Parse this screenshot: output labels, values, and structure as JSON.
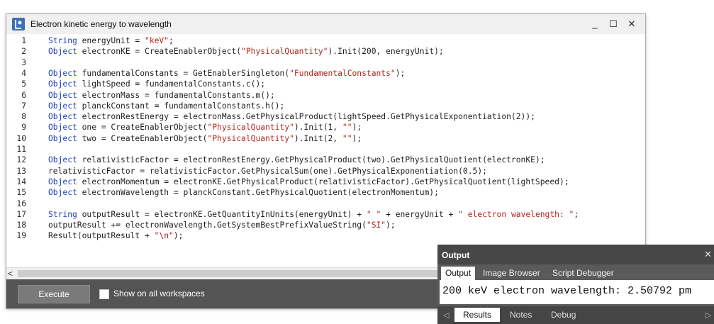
{
  "window": {
    "title": "Electron kinetic energy to wavelength",
    "minimize_label": "_",
    "maximize_label": "☐",
    "close_label": "✕"
  },
  "editor": {
    "lines": [
      {
        "num": "1",
        "tokens": [
          {
            "t": "String",
            "c": "kw"
          },
          {
            "t": " energyUnit = "
          },
          {
            "t": "\"keV\"",
            "c": "str"
          },
          {
            "t": ";"
          }
        ]
      },
      {
        "num": "2",
        "tokens": [
          {
            "t": "Object",
            "c": "kw"
          },
          {
            "t": " electronKE = CreateEnablerObject("
          },
          {
            "t": "\"PhysicalQuantity\"",
            "c": "str"
          },
          {
            "t": ").Init(200, energyUnit);"
          }
        ]
      },
      {
        "num": "3",
        "tokens": []
      },
      {
        "num": "4",
        "tokens": [
          {
            "t": "Object",
            "c": "kw"
          },
          {
            "t": " fundamentalConstants = GetEnablerSingleton("
          },
          {
            "t": "\"FundamentalConstants\"",
            "c": "str"
          },
          {
            "t": ");"
          }
        ]
      },
      {
        "num": "5",
        "tokens": [
          {
            "t": "Object",
            "c": "kw"
          },
          {
            "t": " lightSpeed = fundamentalConstants.c();"
          }
        ]
      },
      {
        "num": "6",
        "tokens": [
          {
            "t": "Object",
            "c": "kw"
          },
          {
            "t": " electronMass = fundamentalConstants.m();"
          }
        ]
      },
      {
        "num": "7",
        "tokens": [
          {
            "t": "Object",
            "c": "kw"
          },
          {
            "t": " planckConstant = fundamentalConstants.h();"
          }
        ]
      },
      {
        "num": "8",
        "tokens": [
          {
            "t": "Object",
            "c": "kw"
          },
          {
            "t": " electronRestEnergy = electronMass.GetPhysicalProduct(lightSpeed.GetPhysicalExponentiation(2));"
          }
        ]
      },
      {
        "num": "9",
        "tokens": [
          {
            "t": "Object",
            "c": "kw"
          },
          {
            "t": " one = CreateEnablerObject("
          },
          {
            "t": "\"PhysicalQuantity\"",
            "c": "str"
          },
          {
            "t": ").Init(1, "
          },
          {
            "t": "\"\"",
            "c": "str"
          },
          {
            "t": ");"
          }
        ]
      },
      {
        "num": "10",
        "tokens": [
          {
            "t": "Object",
            "c": "kw"
          },
          {
            "t": " two = CreateEnablerObject("
          },
          {
            "t": "\"PhysicalQuantity\"",
            "c": "str"
          },
          {
            "t": ").Init(2, "
          },
          {
            "t": "\"\"",
            "c": "str"
          },
          {
            "t": ");"
          }
        ]
      },
      {
        "num": "11",
        "tokens": []
      },
      {
        "num": "12",
        "tokens": [
          {
            "t": "Object",
            "c": "kw"
          },
          {
            "t": " relativisticFactor = electronRestEnergy.GetPhysicalProduct(two).GetPhysicalQuotient(electronKE);"
          }
        ]
      },
      {
        "num": "13",
        "tokens": [
          {
            "t": "relativisticFactor = relativisticFactor.GetPhysicalSum(one).GetPhysicalExponentiation(0.5);"
          }
        ]
      },
      {
        "num": "14",
        "tokens": [
          {
            "t": "Object",
            "c": "kw"
          },
          {
            "t": " electronMomentum = electronKE.GetPhysicalProduct(relativisticFactor).GetPhysicalQuotient(lightSpeed);"
          }
        ]
      },
      {
        "num": "15",
        "tokens": [
          {
            "t": "Object",
            "c": "kw"
          },
          {
            "t": " electronWavelength = planckConstant.GetPhysicalQuotient(electronMomentum);"
          }
        ]
      },
      {
        "num": "16",
        "tokens": []
      },
      {
        "num": "17",
        "tokens": [
          {
            "t": "String",
            "c": "kw"
          },
          {
            "t": " outputResult = electronKE.GetQuantityInUnits(energyUnit) + "
          },
          {
            "t": "\" \"",
            "c": "str"
          },
          {
            "t": " + energyUnit + "
          },
          {
            "t": "\" electron wavelength: \"",
            "c": "str"
          },
          {
            "t": ";"
          }
        ]
      },
      {
        "num": "18",
        "tokens": [
          {
            "t": "outputResult += electronWavelength.GetSystemBestPrefixValueString("
          },
          {
            "t": "\"SI\"",
            "c": "str"
          },
          {
            "t": ");"
          }
        ]
      },
      {
        "num": "19",
        "tokens": [
          {
            "t": "Result(outputResult + "
          },
          {
            "t": "\"\\n\"",
            "c": "str"
          },
          {
            "t": ");"
          }
        ]
      }
    ]
  },
  "scroll": {
    "left_arrow": "<"
  },
  "bottom_bar": {
    "execute_label": "Execute",
    "show_all_label": "Show on all workspaces"
  },
  "output": {
    "title": "Output",
    "close_label": "✕",
    "tabs": [
      "Output",
      "Image Browser",
      "Script Debugger"
    ],
    "text": "200 keV electron wavelength: 2.50792 pm",
    "bottom_tabs": [
      "Results",
      "Notes",
      "Debug"
    ],
    "left_arrow": "◁",
    "right_arrow": "▷"
  }
}
